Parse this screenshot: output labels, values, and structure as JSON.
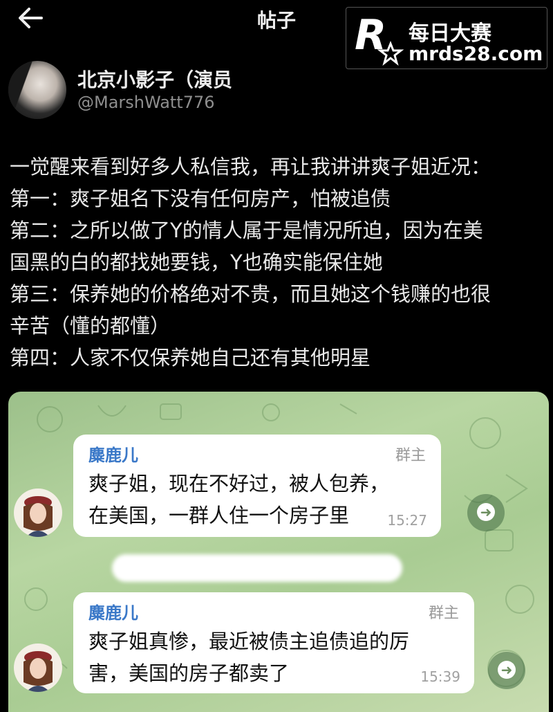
{
  "header": {
    "back_icon": "arrow-left-icon",
    "title": "帖子",
    "more_label": "•••"
  },
  "watermark": {
    "name": "每日大赛",
    "url": "mrds28.com"
  },
  "author": {
    "name": "北京小影子（演员",
    "handle": "@MarshWatt776"
  },
  "post": {
    "lines": [
      "一觉醒来看到好多人私信我，再让我讲讲爽子姐近况：",
      "第一：爽子姐名下没有任何房产，怕被追债",
      "第二：之所以做了Y的情人属于是情况所迫，因为在美",
      "国黑的白的都找她要钱，Y也确实能保住她",
      "第三：保养她的价格绝对不贵，而且她这个钱赚的也很",
      "辛苦（懂的都懂）",
      "第四：人家不仅保养她自己还有其他明星"
    ]
  },
  "messages": [
    {
      "sender": "麋鹿儿",
      "role": "群主",
      "lines": [
        "爽子姐，现在不好过，被人包养，",
        "在美国，一群人住一个房子里"
      ],
      "time": "15:27"
    },
    {
      "sender": "麋鹿儿",
      "role": "群主",
      "lines": [
        "爽子姐真惨，最近被债主追债追的厉",
        "害，美国的房子都卖了"
      ],
      "time": "15:39"
    }
  ],
  "colors": {
    "background": "#000000",
    "chat_bg": "#a9cc93",
    "sender_name": "#3a78c8",
    "bubble": "#ffffff"
  }
}
